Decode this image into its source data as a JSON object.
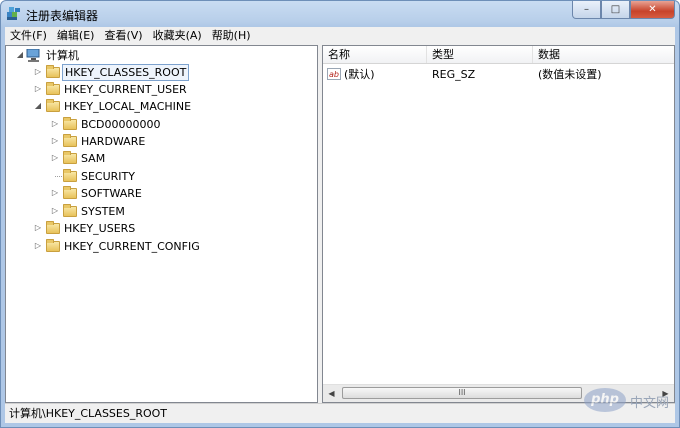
{
  "window": {
    "title": "注册表编辑器"
  },
  "caption": {
    "minimize": "–",
    "maximize": "□",
    "close": "✕"
  },
  "menu": [
    "文件(F)",
    "编辑(E)",
    "查看(V)",
    "收藏夹(A)",
    "帮助(H)"
  ],
  "tree": {
    "root": "计算机",
    "nodes": [
      {
        "label": "HKEY_CLASSES_ROOT",
        "expander": "▷",
        "selected": true
      },
      {
        "label": "HKEY_CURRENT_USER",
        "expander": "▷"
      },
      {
        "label": "HKEY_LOCAL_MACHINE",
        "expander": "◢"
      },
      {
        "label": "BCD00000000",
        "expander": "▷"
      },
      {
        "label": "HARDWARE",
        "expander": "▷"
      },
      {
        "label": "SAM",
        "expander": "▷"
      },
      {
        "label": "SECURITY",
        "expander": ""
      },
      {
        "label": "SOFTWARE",
        "expander": "▷"
      },
      {
        "label": "SYSTEM",
        "expander": "▷"
      },
      {
        "label": "HKEY_USERS",
        "expander": "▷"
      },
      {
        "label": "HKEY_CURRENT_CONFIG",
        "expander": "▷"
      }
    ]
  },
  "list": {
    "columns": [
      "名称",
      "类型",
      "数据"
    ],
    "rows": [
      {
        "icon": "ab",
        "name": "(默认)",
        "type": "REG_SZ",
        "data": "(数值未设置)"
      }
    ],
    "scroll_thumb": "III"
  },
  "status": {
    "path": "计算机\\HKEY_CLASSES_ROOT"
  },
  "watermark": {
    "logo": "php",
    "text": "中文网"
  },
  "colors": {
    "selection_border": "#7da2ce",
    "folder": "#e8c25a"
  }
}
